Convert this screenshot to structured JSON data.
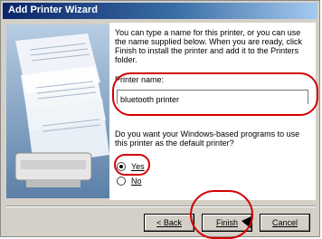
{
  "window": {
    "title": "Add Printer Wizard"
  },
  "wizard": {
    "intro": "You can type a name for this printer, or you can use the name supplied below. When you are ready, click Finish to install the printer and add it to the Printers folder.",
    "printer_name_label": "Printer name:",
    "printer_name_value": "bluetooth printer",
    "default_question": "Do you want your Windows-based programs to use this printer as the default printer?",
    "options": [
      {
        "label": "Yes",
        "selected": true
      },
      {
        "label": "No",
        "selected": false
      }
    ]
  },
  "buttons": {
    "back": "< Back",
    "finish": "Finish",
    "cancel": "Cancel"
  },
  "colors": {
    "highlight": "#d40000",
    "title_bar": "#0a246a"
  },
  "icons": {
    "art": "printer-paper-illustration",
    "radio_checked": "radio-checked-icon",
    "radio_unchecked": "radio-unchecked-icon",
    "cursor": "mouse-cursor-icon"
  }
}
